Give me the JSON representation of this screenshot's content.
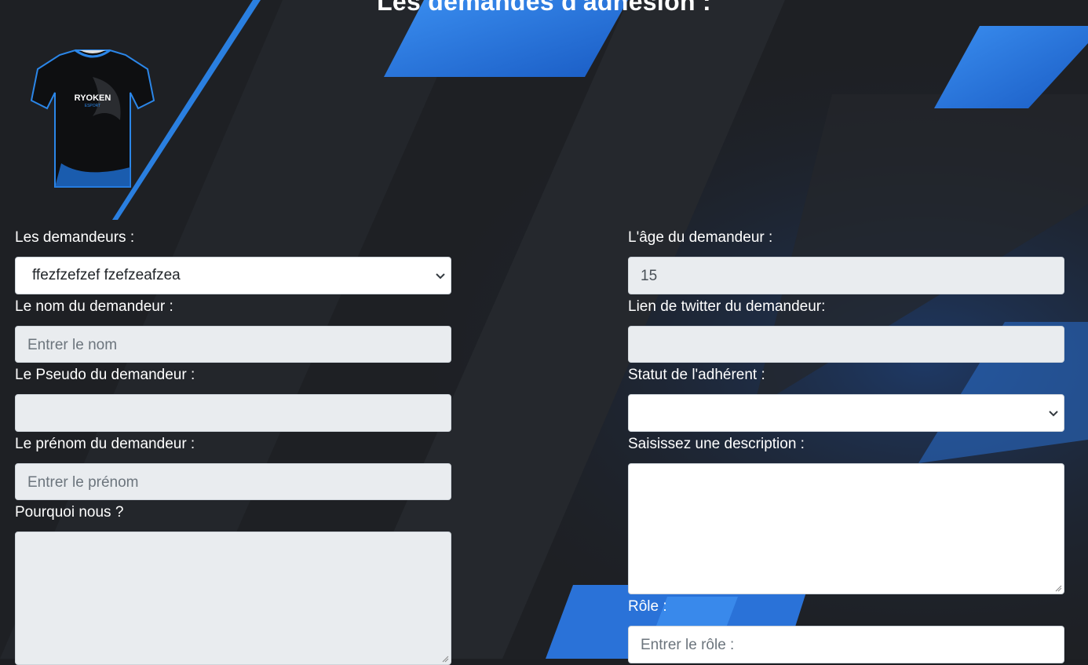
{
  "page": {
    "title": "Les demandes d'adhésion :"
  },
  "logo": {
    "text": "RYOKEN",
    "subtext": "ESPORT"
  },
  "left": {
    "demandeurs": {
      "label": "Les demandeurs :",
      "value": "ffezfzefzef fzefzeafzea"
    },
    "nom": {
      "label": "Le nom du demandeur :",
      "placeholder": "Entrer le nom"
    },
    "pseudo": {
      "label": "Le Pseudo du demandeur :",
      "value": ""
    },
    "prenom": {
      "label": "Le prénom du demandeur :",
      "placeholder": "Entrer le prénom"
    },
    "pourquoi": {
      "label": "Pourquoi nous ?",
      "value": ""
    }
  },
  "right": {
    "age": {
      "label": "L'âge du demandeur :",
      "value": "15"
    },
    "twitter": {
      "label": "Lien de twitter du demandeur:",
      "value": ""
    },
    "statut": {
      "label": "Statut de l'adhérent :",
      "value": ""
    },
    "description": {
      "label": "Saisissez une description :",
      "value": ""
    },
    "role": {
      "label": "Rôle :",
      "placeholder": "Entrer le rôle :"
    }
  },
  "colors": {
    "accent": "#2a7fe0",
    "background": "#1d1f23",
    "input_gray": "#e9ecef"
  }
}
